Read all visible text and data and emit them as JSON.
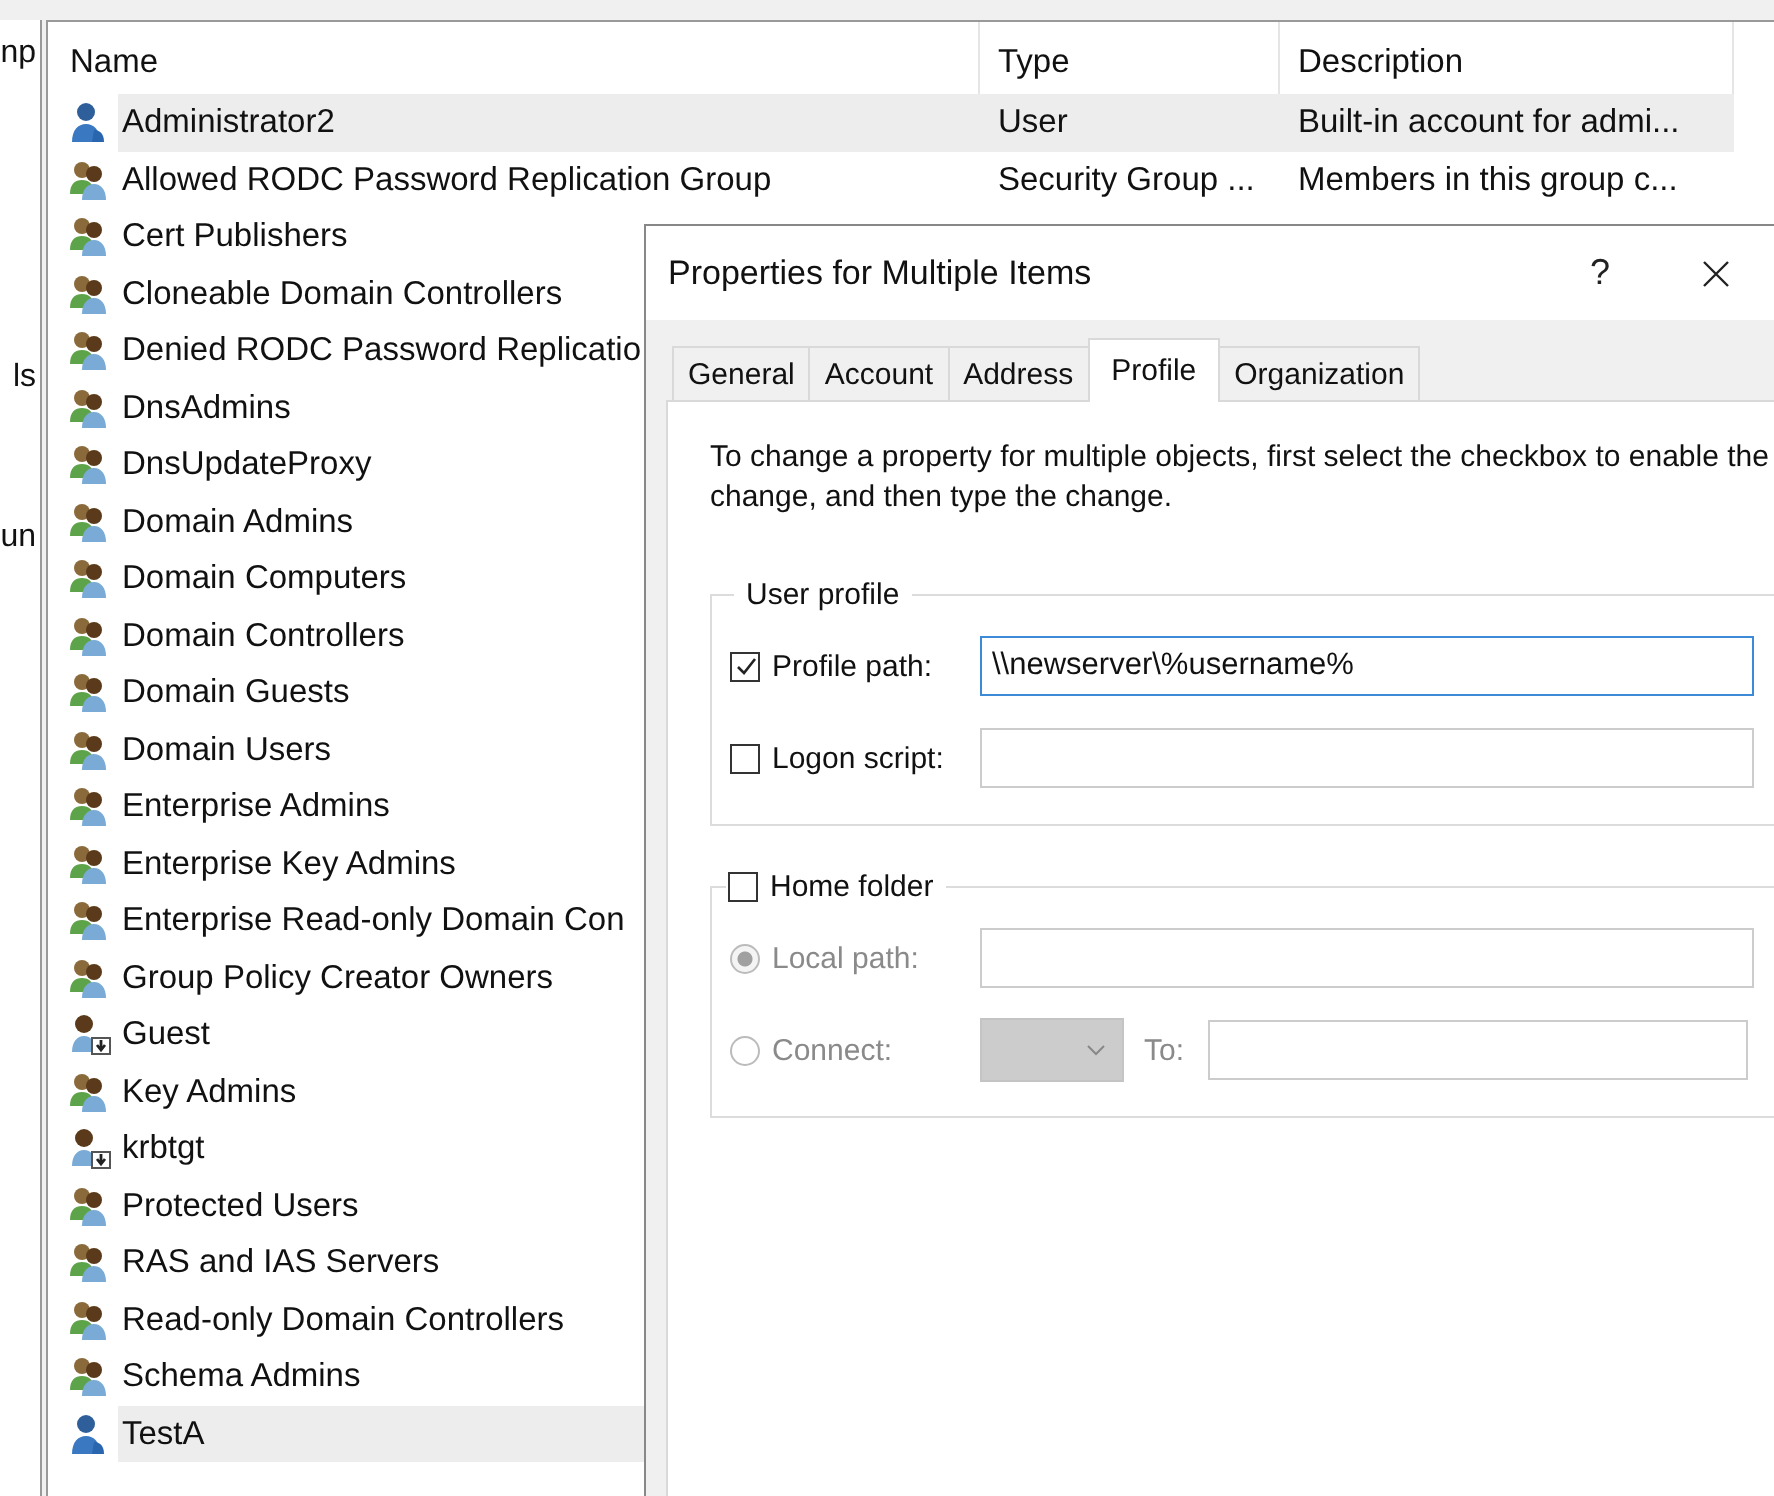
{
  "left_pane": {
    "items": [
      "np",
      "ls",
      "un"
    ]
  },
  "list": {
    "columns": [
      "Name",
      "Type",
      "Description"
    ],
    "rows": [
      {
        "name": "Administrator2",
        "type": "User",
        "description": "Built-in account for admi...",
        "kind": "user",
        "selected": true
      },
      {
        "name": "Allowed RODC Password Replication Group",
        "type": "Security Group ...",
        "description": "Members in this group c...",
        "kind": "group",
        "selected": false
      },
      {
        "name": "Cert Publishers",
        "kind": "group",
        "selected": false
      },
      {
        "name": "Cloneable Domain Controllers",
        "kind": "group",
        "selected": false
      },
      {
        "name": "Denied RODC Password Replicatio",
        "kind": "group",
        "selected": false
      },
      {
        "name": "DnsAdmins",
        "kind": "group",
        "selected": false
      },
      {
        "name": "DnsUpdateProxy",
        "kind": "group",
        "selected": false
      },
      {
        "name": "Domain Admins",
        "kind": "group",
        "selected": false
      },
      {
        "name": "Domain Computers",
        "kind": "group",
        "selected": false
      },
      {
        "name": "Domain Controllers",
        "kind": "group",
        "selected": false
      },
      {
        "name": "Domain Guests",
        "kind": "group",
        "selected": false
      },
      {
        "name": "Domain Users",
        "kind": "group",
        "selected": false
      },
      {
        "name": "Enterprise Admins",
        "kind": "group",
        "selected": false
      },
      {
        "name": "Enterprise Key Admins",
        "kind": "group",
        "selected": false
      },
      {
        "name": "Enterprise Read-only Domain Con",
        "kind": "group",
        "selected": false
      },
      {
        "name": "Group Policy Creator Owners",
        "kind": "group",
        "selected": false
      },
      {
        "name": "Guest",
        "kind": "disabled_user",
        "selected": false
      },
      {
        "name": "Key Admins",
        "kind": "group",
        "selected": false
      },
      {
        "name": "krbtgt",
        "kind": "disabled_user",
        "selected": false
      },
      {
        "name": "Protected Users",
        "kind": "group",
        "selected": false
      },
      {
        "name": "RAS and IAS Servers",
        "kind": "group",
        "selected": false
      },
      {
        "name": "Read-only Domain Controllers",
        "kind": "group",
        "selected": false
      },
      {
        "name": "Schema Admins",
        "kind": "group",
        "selected": false
      },
      {
        "name": "TestA",
        "kind": "user",
        "selected": true
      }
    ]
  },
  "dialog": {
    "title": "Properties for Multiple Items",
    "help": "?",
    "tabs": [
      {
        "label": "General",
        "selected": false
      },
      {
        "label": "Account",
        "selected": false
      },
      {
        "label": "Address",
        "selected": false
      },
      {
        "label": "Profile",
        "selected": true
      },
      {
        "label": "Organization",
        "selected": false
      }
    ],
    "instructions": "To change a property for multiple objects, first select the checkbox to enable the change, and then type the change.",
    "user_profile": {
      "title": "User profile",
      "fields": [
        {
          "label": "Profile path:",
          "checked": true,
          "value": "\\\\newserver\\%username%",
          "focused": true
        },
        {
          "label": "Logon script:",
          "checked": false,
          "focused": false
        }
      ]
    },
    "home_folder": {
      "label": "Home folder",
      "checked": false,
      "options": [
        {
          "kind": "path",
          "label": "Local path:",
          "selected": true,
          "disabled": true
        },
        {
          "kind": "connect",
          "label": "Connect:",
          "selected": false,
          "disabled": true,
          "to_label": "To:"
        }
      ]
    }
  }
}
